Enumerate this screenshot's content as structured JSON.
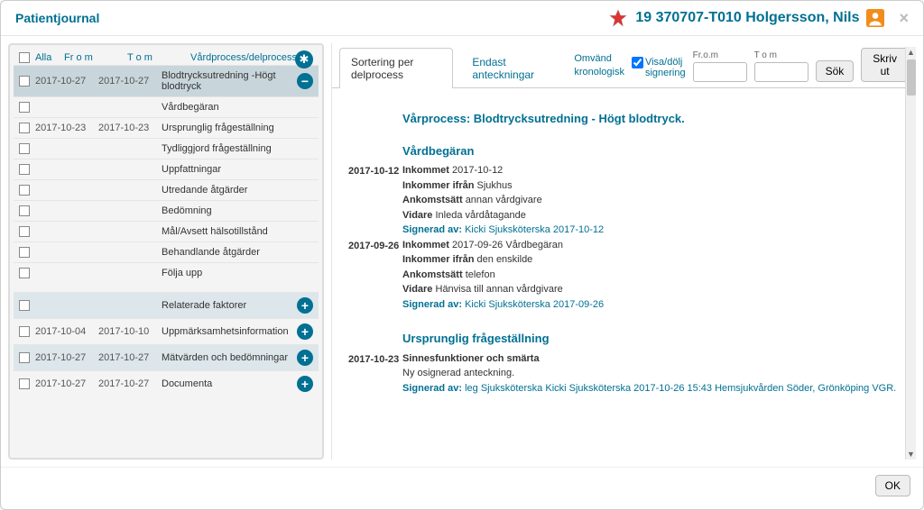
{
  "header": {
    "title": "Patientjournal",
    "patient_id": "19 370707-T010 Holgersson, Nils"
  },
  "left": {
    "cols": {
      "alla": "Alla",
      "from": "Fr o m",
      "to": "T o m",
      "proc": "Vårdprocess/delprocess"
    },
    "rows": [
      {
        "from": "2017-10-27",
        "to": "2017-10-27",
        "proc": "Blodtrycksutredning -Högt blodtryck",
        "icon": "minus",
        "sel": true
      },
      {
        "from": "",
        "to": "",
        "proc": "Vårdbegäran"
      },
      {
        "from": "2017-10-23",
        "to": "2017-10-23",
        "proc": "Ursprunglig frågeställning"
      },
      {
        "from": "",
        "to": "",
        "proc": "Tydliggjord frågeställning"
      },
      {
        "from": "",
        "to": "",
        "proc": "Uppfattningar"
      },
      {
        "from": "",
        "to": "",
        "proc": "Utredande åtgärder"
      },
      {
        "from": "",
        "to": "",
        "proc": "Bedömning"
      },
      {
        "from": "",
        "to": "",
        "proc": "Mål/Avsett hälsotillstånd"
      },
      {
        "from": "",
        "to": "",
        "proc": "Behandlande åtgärder"
      },
      {
        "from": "",
        "to": "",
        "proc": "Följa upp"
      }
    ],
    "extra": [
      {
        "from": "",
        "to": "",
        "proc": "Relaterade faktorer",
        "icon": "plus",
        "blue": true
      },
      {
        "from": "2017-10-04",
        "to": "2017-10-10",
        "proc": "Uppmärksamhetsinformation",
        "icon": "plus"
      },
      {
        "from": "2017-10-27",
        "to": "2017-10-27",
        "proc": "Mätvärden och bedömningar",
        "icon": "plus",
        "blue": true
      },
      {
        "from": "2017-10-27",
        "to": "2017-10-27",
        "proc": "Documenta",
        "icon": "plus"
      }
    ]
  },
  "toolbar": {
    "tab_sort": "Sortering per delprocess",
    "tab_notes": "Endast anteckningar",
    "link_reverse": "Omvänd\nkronologisk",
    "chk_signing": "Visa/dölj\nsignering",
    "lbl_from": "Fr.o.m",
    "lbl_to": "T o m",
    "btn_search": "Sök",
    "btn_print": "Skriv ut"
  },
  "content": {
    "process_title": "Vårprocess: Blodtrycksutredning - Högt blodtryck.",
    "section1_title": "Vårdbegäran",
    "entry1_date": "2017-10-12",
    "e1_l1a": "Inkommet",
    "e1_l1b": "2017-10-12",
    "e1_l2a": "Inkommer ifrån",
    "e1_l2b": "Sjukhus",
    "e1_l3a": "Ankomstsätt",
    "e1_l3b": "annan vårdgivare",
    "e1_l4a": "Vidare",
    "e1_l4b": "Inleda vårdåtagande",
    "e1_sign_lbl": "Signerad av:",
    "e1_sign": "Kicki Sjuksköterska 2017-10-12",
    "entry2_date": "2017-09-26",
    "e2_l1a": "Inkommet",
    "e2_l1b": "2017-09-26 Vårdbegäran",
    "e2_l2a": "Inkommer ifrån",
    "e2_l2b": "den enskilde",
    "e2_l3a": "Ankomstsätt",
    "e2_l3b": "telefon",
    "e2_l4a": "Vidare",
    "e2_l4b": "Hänvisa till annan vårdgivare",
    "e2_sign_lbl": "Signerad av:",
    "e2_sign": "Kicki Sjuksköterska 2017-09-26",
    "section2_title": "Ursprunglig frågeställning",
    "entry3_date": "2017-10-23",
    "e3_l1": "Sinnesfunktioner och smärta",
    "e3_l2": "Ny osignerad anteckning.",
    "e3_sign_lbl": "Signerad av:",
    "e3_sign": "leg Sjuksköterska Kicki Sjuksköterska 2017-10-26 15:43 Hemsjukvården Söder, Grönköping VGR."
  },
  "footer": {
    "ok": "OK"
  }
}
